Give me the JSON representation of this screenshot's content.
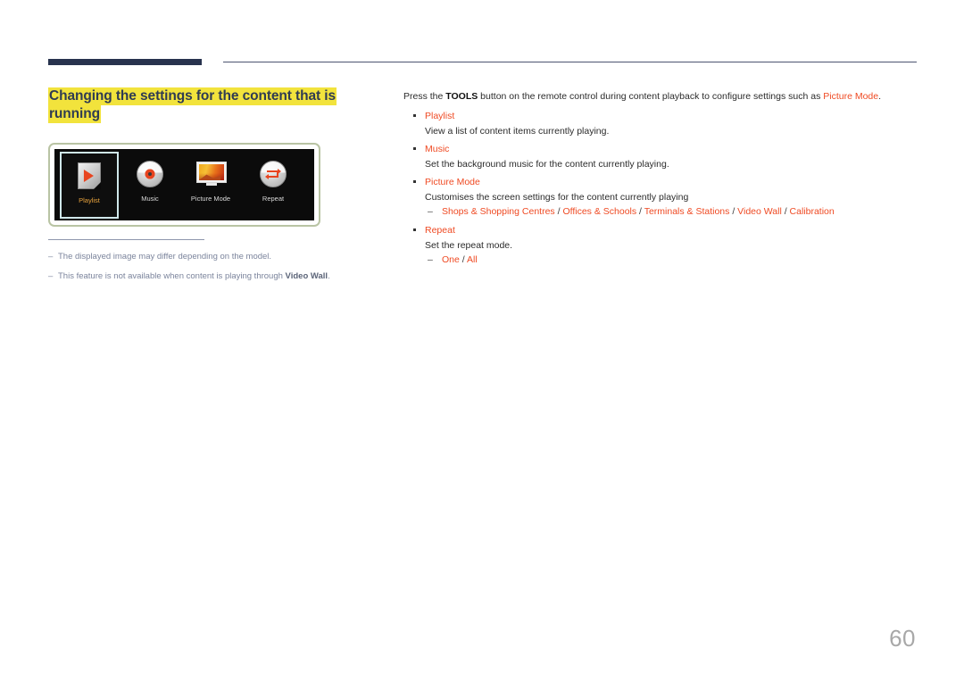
{
  "header": {
    "rule_color": "#28334e"
  },
  "left": {
    "title": "Changing the settings for the content that is running",
    "device": {
      "tiles": [
        {
          "label": "Playlist",
          "icon": "playlist-document-play-icon",
          "selected": true
        },
        {
          "label": "Music",
          "icon": "music-cd-disc-icon",
          "selected": false
        },
        {
          "label": "Picture Mode",
          "icon": "picture-mode-monitor-icon",
          "selected": false
        },
        {
          "label": "Repeat",
          "icon": "repeat-loop-arrows-icon",
          "selected": false
        }
      ]
    },
    "notes": [
      {
        "dash": "–",
        "text": "The displayed image may differ depending on the model."
      },
      {
        "dash": "–",
        "text_before": "This feature is not available when content is playing through ",
        "bold": "Video Wall",
        "text_after": "."
      }
    ]
  },
  "right": {
    "intro": {
      "part1": "Press the ",
      "bold": "TOOLS",
      "part2": " button on the remote control during content playback to configure settings such as ",
      "accent": "Picture Mode",
      "part3": "."
    },
    "bullets": [
      {
        "title": "Playlist",
        "desc": "View a list of content items currently playing.",
        "suboptions": []
      },
      {
        "title": "Music",
        "desc": "Set the background music for the content currently playing.",
        "suboptions": []
      },
      {
        "title": "Picture Mode",
        "desc": "Customises the screen settings for the content currently playing",
        "suboptions": [
          {
            "options": [
              "Shops & Shopping Centres",
              "Offices & Schools",
              "Terminals & Stations",
              "Video Wall",
              "Calibration"
            ],
            "separator": " / "
          }
        ]
      },
      {
        "title": "Repeat",
        "desc": "Set the repeat mode.",
        "suboptions": [
          {
            "options": [
              "One",
              "All"
            ],
            "separator": " / "
          }
        ]
      }
    ]
  },
  "footer": {
    "page_number": "60"
  },
  "colors": {
    "accent": "#ef4a23",
    "highlight": "#f2e33c",
    "title": "#2f3b52",
    "note": "#7b849c",
    "header_rule": "#28334e",
    "page_number": "#a8a8a8"
  }
}
